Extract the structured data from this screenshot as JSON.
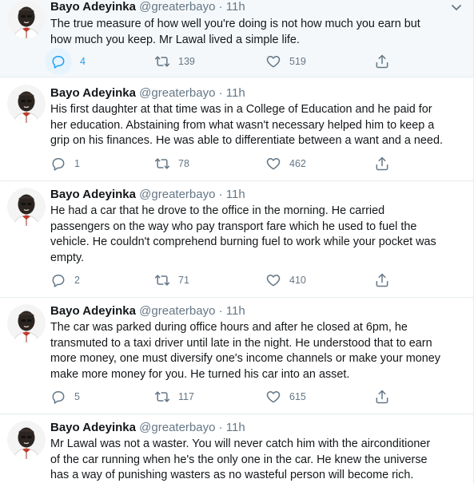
{
  "author": {
    "display_name": "Bayo Adeyinka",
    "handle": "@greaterbayo",
    "separator": "·",
    "time": "11h"
  },
  "colors": {
    "text": "#14171a",
    "muted": "#657786",
    "accent": "#1da1f2",
    "highlight_bg": "#f5f8fa",
    "divider": "#e6ecf0"
  },
  "icons": {
    "reply": "reply-icon",
    "retweet": "retweet-icon",
    "like": "heart-icon",
    "share": "share-icon",
    "caret": "chevron-down-icon",
    "avatar": "avatar-image"
  },
  "tweets": [
    {
      "text": "The true measure of how well you're doing is not how much you earn but\nhow much you keep. Mr Lawal lived a simple life.",
      "replies": "4",
      "retweets": "139",
      "likes": "519",
      "highlighted": true
    },
    {
      "text": "His first daughter at that time was in a College of Education and he paid for\nher education. Abstaining from what wasn't necessary helped him to keep a\ngrip on his finances. He was able to differentiate between a want and a need.",
      "replies": "1",
      "retweets": "78",
      "likes": "462"
    },
    {
      "text": "He had a car that he drove to the office in the morning. He carried\npassengers on the way who pay transport fare which he used to fuel the\nvehicle. He couldn't comprehend burning fuel to work while your pocket was\nempty.",
      "replies": "2",
      "retweets": "71",
      "likes": "410"
    },
    {
      "text": "The car was parked during office hours and after he closed at 6pm, he\ntransmuted to a taxi driver until late in the night. He understood that to earn\nmore money, one must diversify one's income channels or make your money\nmake more money for you. He turned his car into an asset.",
      "replies": "5",
      "retweets": "117",
      "likes": "615"
    },
    {
      "text": "Mr Lawal was not a waster. You will never catch him with the airconditioner\nof the car running when he's the only one in the car. He knew the universe\nhas a way of punishing wasters as no wasteful person will become rich."
    }
  ]
}
